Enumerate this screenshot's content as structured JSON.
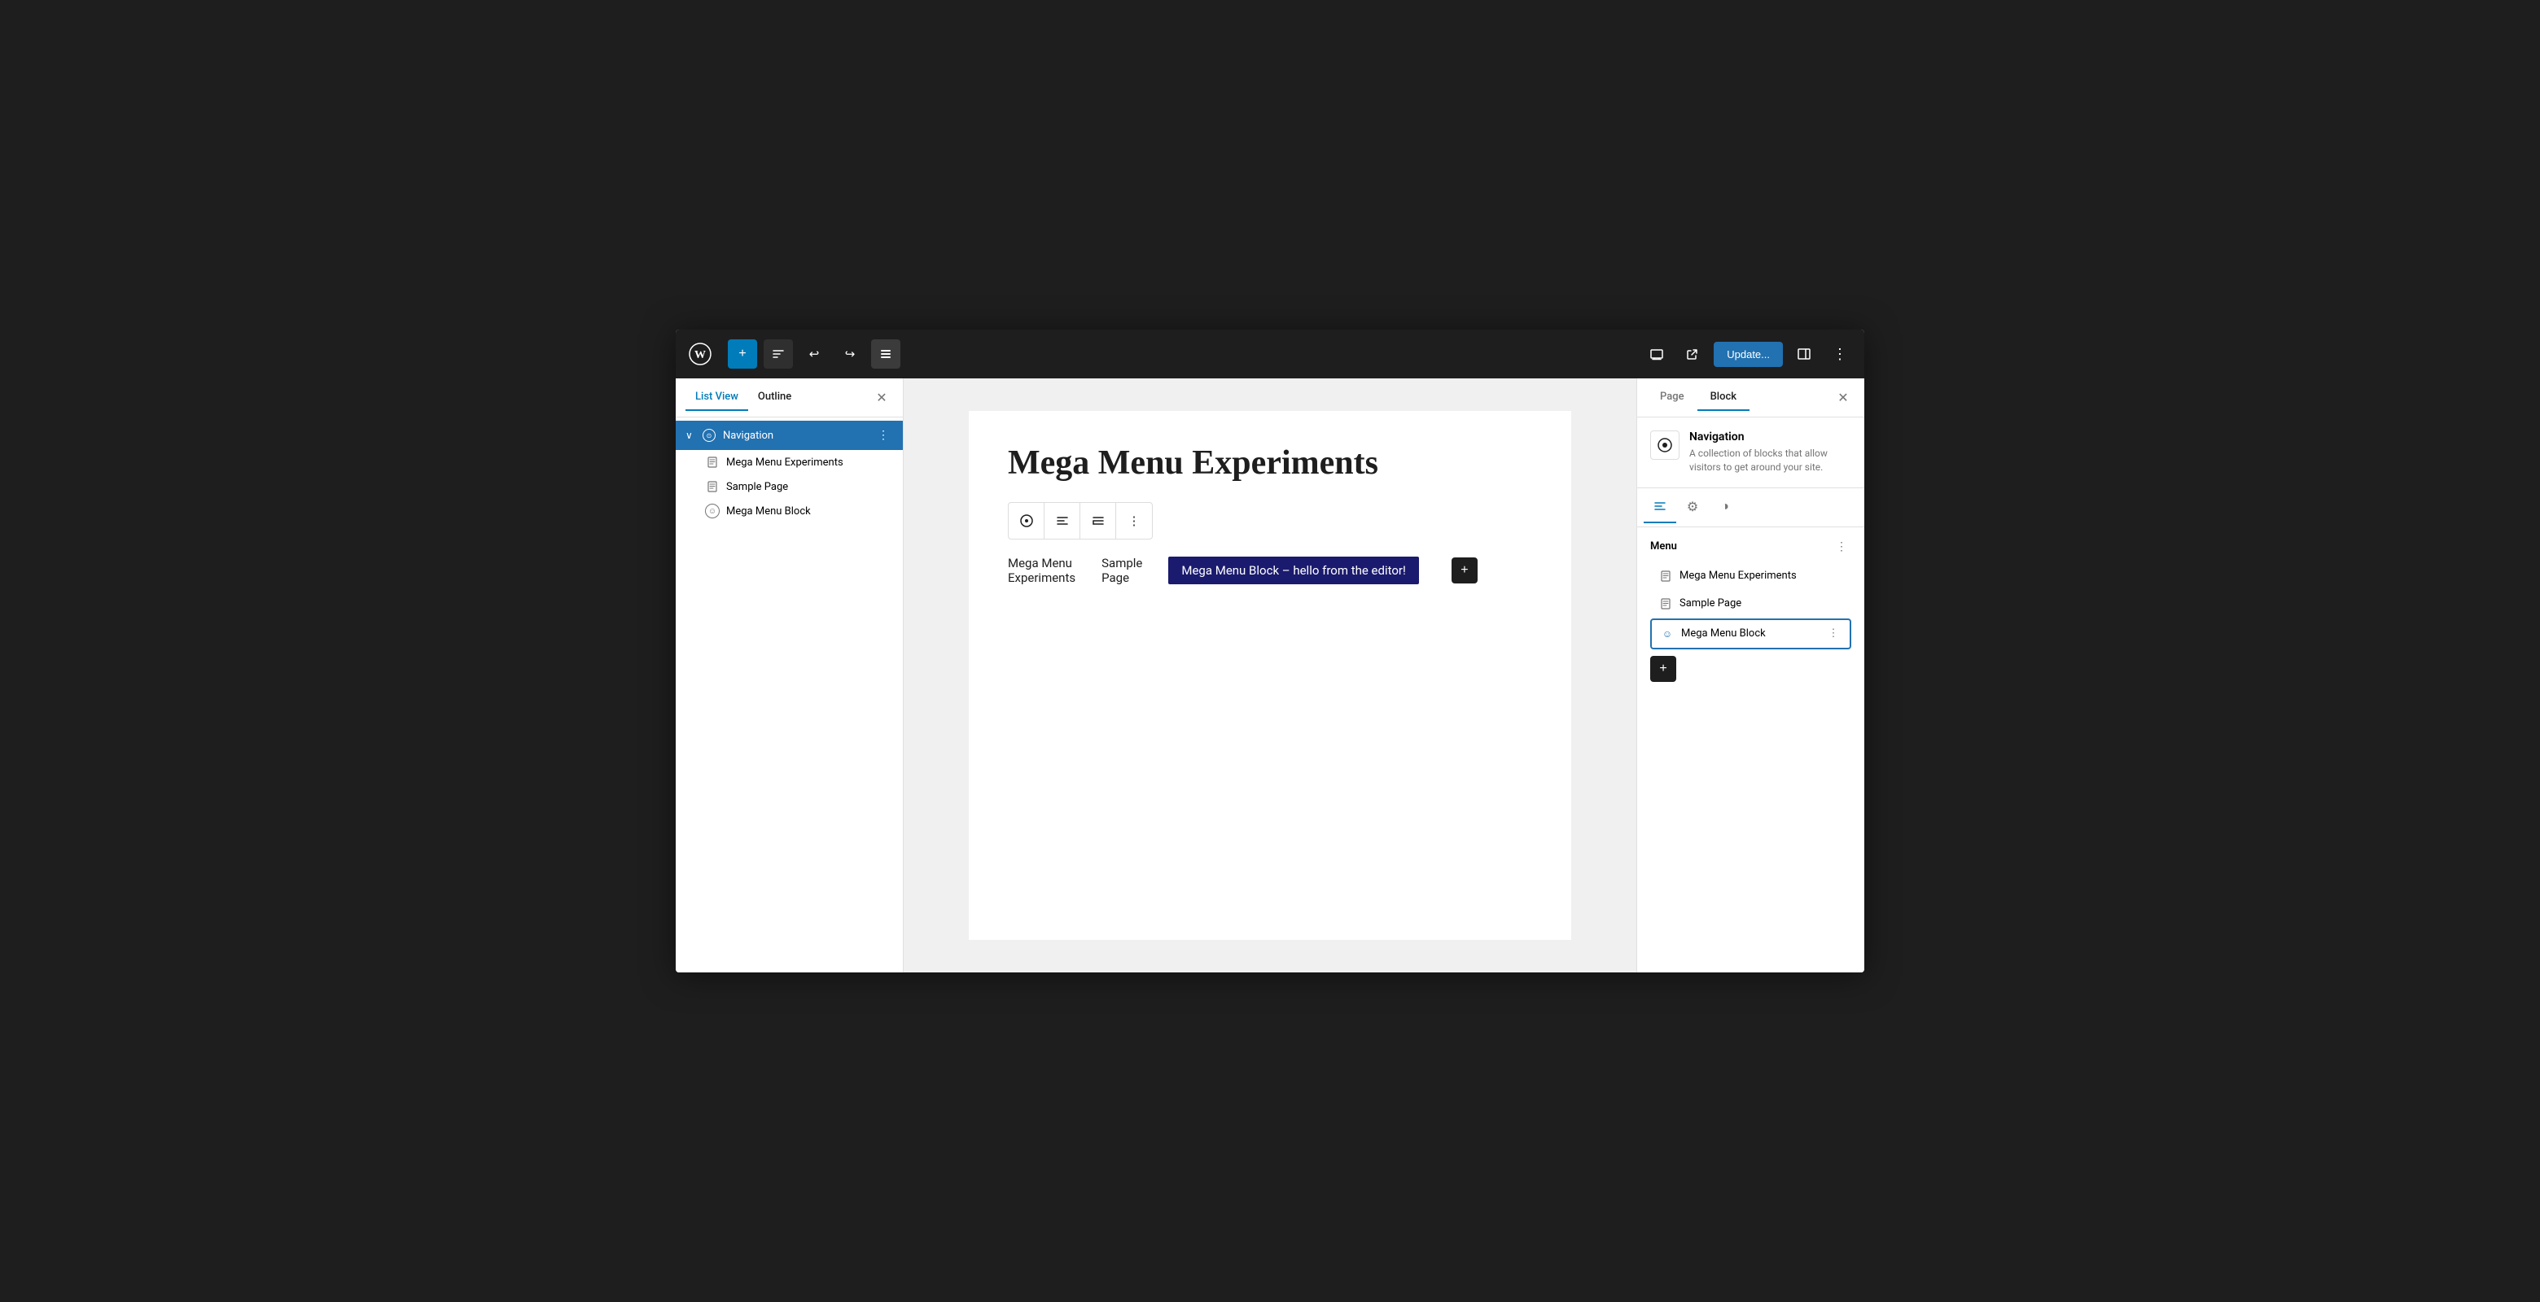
{
  "toolbar": {
    "add_label": "+",
    "undo_label": "↩",
    "redo_label": "↪",
    "view_icon": "☰",
    "update_label": "Update...",
    "preview_icon": "⬜",
    "external_icon": "↗",
    "sidebar_icon": "▣",
    "more_icon": "⋮"
  },
  "left_sidebar": {
    "tab_list_view": "List View",
    "tab_outline": "Outline",
    "close_icon": "✕",
    "items": [
      {
        "id": "navigation",
        "label": "Navigation",
        "icon": "circle",
        "selected": true,
        "level": 0,
        "has_chevron": true,
        "chevron": "›"
      },
      {
        "id": "mega-menu-experiments",
        "label": "Mega Menu Experiments",
        "icon": "doc",
        "selected": false,
        "level": 1
      },
      {
        "id": "sample-page",
        "label": "Sample Page",
        "icon": "doc",
        "selected": false,
        "level": 1
      },
      {
        "id": "mega-menu-block",
        "label": "Mega Menu Block",
        "icon": "smile",
        "selected": false,
        "level": 1
      }
    ]
  },
  "canvas": {
    "page_title": "Mega Menu Experiments",
    "nav_menu_items": [
      {
        "id": "item1",
        "label": "Mega Menu\nExperiments",
        "highlighted": false
      },
      {
        "id": "item2",
        "label": "Sample\nPage",
        "highlighted": false
      },
      {
        "id": "item3",
        "label": "Mega Menu Block – hello from the editor!",
        "highlighted": true
      }
    ]
  },
  "right_sidebar": {
    "tab_page": "Page",
    "tab_block": "Block",
    "close_icon": "✕",
    "block_info": {
      "icon": "⊙",
      "title": "Navigation",
      "description": "A collection of blocks that allow visitors to get around your site."
    },
    "icon_tabs": [
      {
        "id": "layout",
        "icon": "≡",
        "active": true
      },
      {
        "id": "settings",
        "icon": "⚙",
        "active": false
      },
      {
        "id": "style",
        "icon": "◑",
        "active": false
      }
    ],
    "menu_section": {
      "title": "Menu",
      "more_icon": "⋮",
      "items": [
        {
          "id": "mega-menu-experiments",
          "label": "Mega Menu Experiments",
          "icon": "doc",
          "selected": false
        },
        {
          "id": "sample-page",
          "label": "Sample Page",
          "icon": "doc",
          "selected": false
        },
        {
          "id": "mega-menu-block",
          "label": "Mega Menu Block",
          "icon": "smile",
          "selected": true
        }
      ],
      "add_icon": "+"
    }
  }
}
